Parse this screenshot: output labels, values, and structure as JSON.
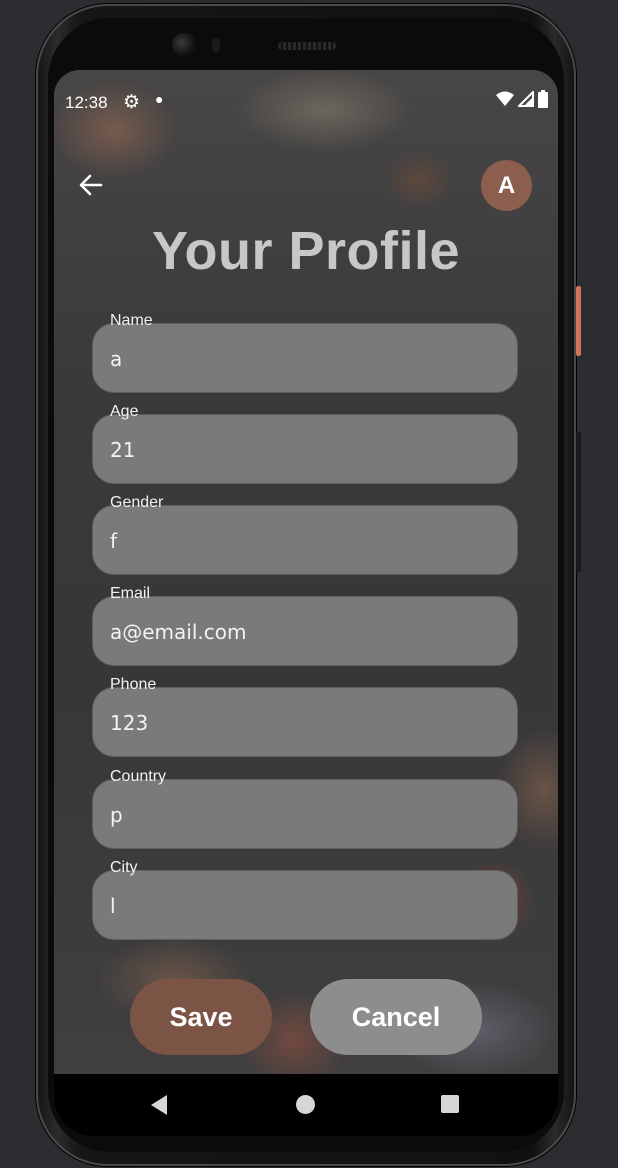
{
  "status_bar": {
    "time": "12:38",
    "icons": [
      "settings-gear-icon",
      "notification-dot-icon",
      "wifi-icon",
      "cell-signal-icon",
      "battery-icon"
    ]
  },
  "header": {
    "back_icon": "arrow-left-icon",
    "avatar_initial": "A",
    "title": "Your Profile"
  },
  "form": {
    "fields": [
      {
        "label": "Name",
        "value": "a"
      },
      {
        "label": "Age",
        "value": "21"
      },
      {
        "label": "Gender",
        "value": "f"
      },
      {
        "label": "Email",
        "value": "a@email.com"
      },
      {
        "label": "Phone",
        "value": "123"
      },
      {
        "label": "Country",
        "value": "p"
      },
      {
        "label": "City",
        "value": "l"
      }
    ]
  },
  "actions": {
    "save_label": "Save",
    "cancel_label": "Cancel"
  },
  "nav_bar": {
    "icons": [
      "nav-back-icon",
      "nav-home-icon",
      "nav-recents-icon"
    ]
  },
  "colors": {
    "accent": "#7c5446",
    "avatar": "#8c5e4d",
    "field_background": "#7b7a7a",
    "cancel_button": "#8e8d8e",
    "title_text": "#c9c7c6"
  }
}
